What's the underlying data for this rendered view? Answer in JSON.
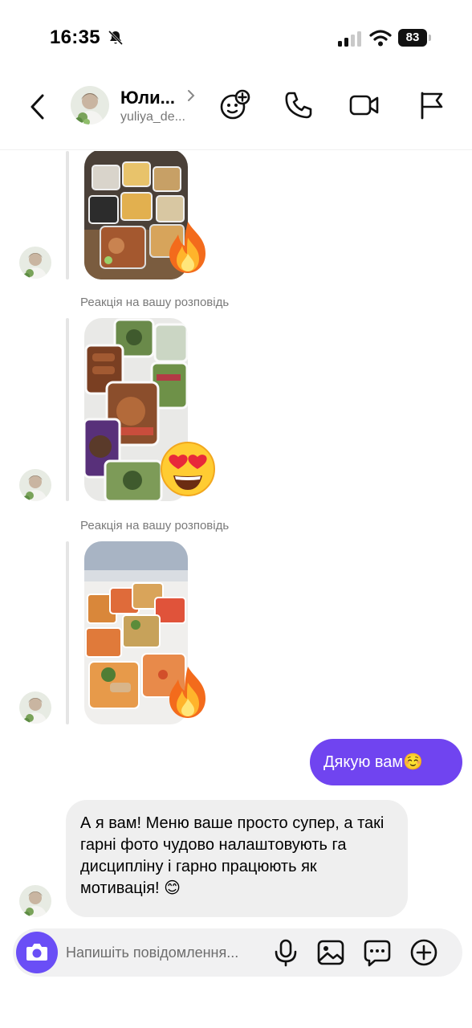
{
  "status_bar": {
    "time": "16:35",
    "battery": "83"
  },
  "header": {
    "contact_name": "Юли...",
    "username": "yuliya_de..."
  },
  "thread": {
    "reactions": [
      {
        "label": "Реакція на вашу розповідь",
        "emoji": "fire-emoji"
      },
      {
        "label": "Реакція на вашу розповідь",
        "emoji": "heart-eyes-emoji"
      },
      {
        "label": "Реакція на вашу розповідь",
        "emoji": "fire-emoji"
      }
    ],
    "outgoing_message": "Дякую вам☺️",
    "incoming_message": "А я вам! Меню ваше просто супер, а такі гарні фото чудово налаштовують га дисципліну і гарно працюють як мотивація! 😊"
  },
  "composer": {
    "placeholder": "Напишіть повідомлення..."
  },
  "colors": {
    "accent": "#7044f0",
    "camera": "#6a4ef6",
    "bubble_in": "#efefef"
  }
}
